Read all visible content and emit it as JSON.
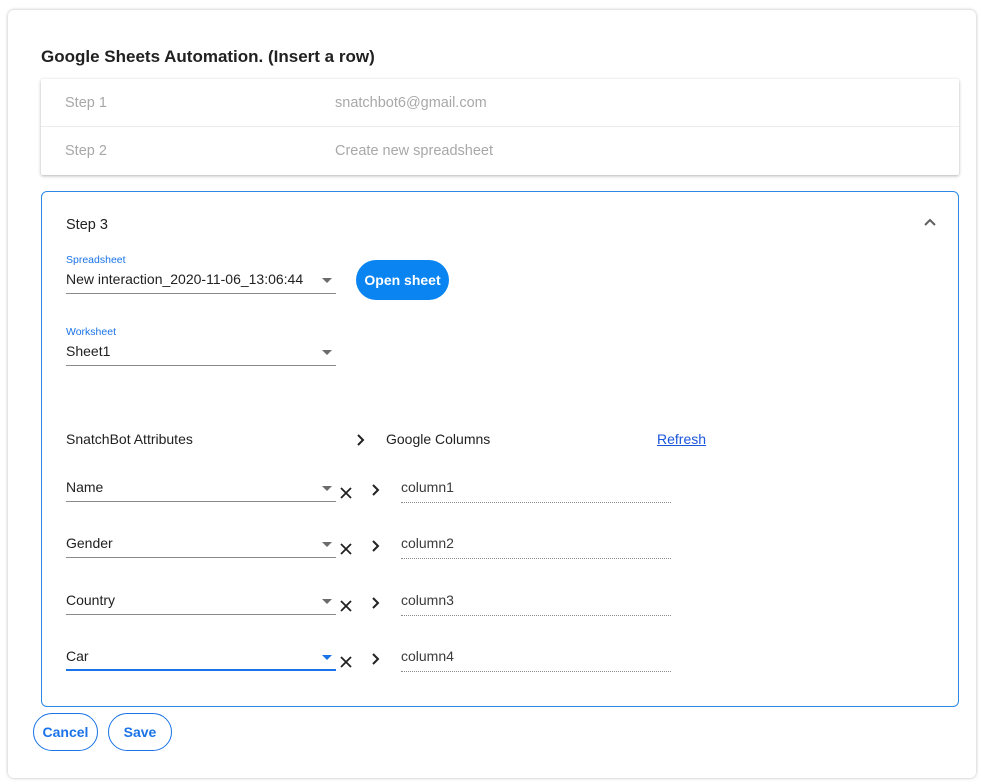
{
  "title": "Google Sheets Automation. (Insert a row)",
  "steps": [
    {
      "label": "Step 1",
      "value": "snatchbot6@gmail.com"
    },
    {
      "label": "Step 2",
      "value": "Create new spreadsheet"
    }
  ],
  "step3": {
    "title": "Step 3",
    "spreadsheet": {
      "label": "Spreadsheet",
      "value": "New interaction_2020-11-06_13:06:44"
    },
    "open_sheet_label": "Open sheet",
    "worksheet": {
      "label": "Worksheet",
      "value": "Sheet1"
    },
    "mapping_header": {
      "attributes": "SnatchBot Attributes",
      "columns": "Google Columns",
      "refresh": "Refresh"
    },
    "mappings": [
      {
        "attribute": "Name",
        "column": "column1"
      },
      {
        "attribute": "Gender",
        "column": "column2"
      },
      {
        "attribute": "Country",
        "column": "column3"
      },
      {
        "attribute": "Car",
        "column": "column4"
      }
    ]
  },
  "actions": {
    "cancel": "Cancel",
    "save": "Save"
  },
  "icons": {
    "collapse": "chevron-up-icon",
    "dropdown": "caret-down-icon",
    "clear": "close-icon",
    "arrow": "chevron-right-icon"
  },
  "colors": {
    "accent": "#1a73e8",
    "primary_button": "#0a84f0",
    "panel_border": "#2d89e5"
  }
}
